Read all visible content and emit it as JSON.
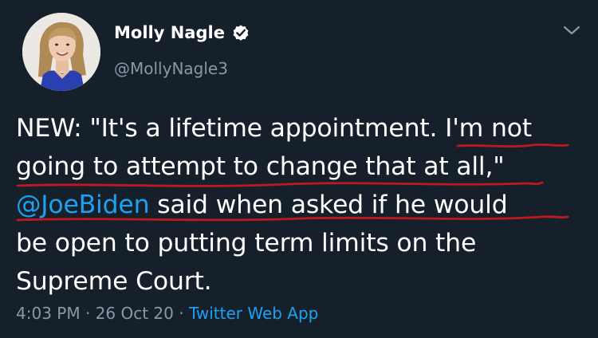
{
  "author": {
    "display_name": "Molly Nagle",
    "handle": "@MollyNagle3",
    "verified": true,
    "verified_icon": "verified-badge-icon"
  },
  "tweet": {
    "line1": "NEW: \"It's a lifetime appointment. I'm not",
    "line2": "going to attempt to change that at all,\"",
    "line3_mention": "@JoeBiden",
    "line3_rest": " said when asked if he would",
    "line4": "be open to putting term limits on the",
    "line5": "Supreme Court."
  },
  "meta": {
    "time": "4:03 PM",
    "separator": " · ",
    "date": "26 Oct 20",
    "source": "Twitter Web App"
  },
  "colors": {
    "background": "#15202b",
    "link": "#1da1f2",
    "secondary_text": "#8899a6",
    "annotation_underline": "#c0181f"
  },
  "icons": {
    "menu": "chevron-down-icon",
    "verified": "verified-badge-icon"
  }
}
